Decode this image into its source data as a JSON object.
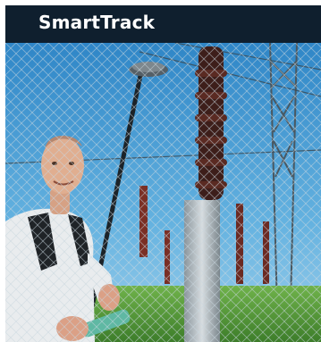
{
  "card": {
    "title": "SmartTrack"
  },
  "colors": {
    "header_background": "#0f1f2e",
    "title_text": "#ffffff"
  },
  "icons": {
    "photo": "surveyor-with-gps-pole-at-substation-photo"
  }
}
